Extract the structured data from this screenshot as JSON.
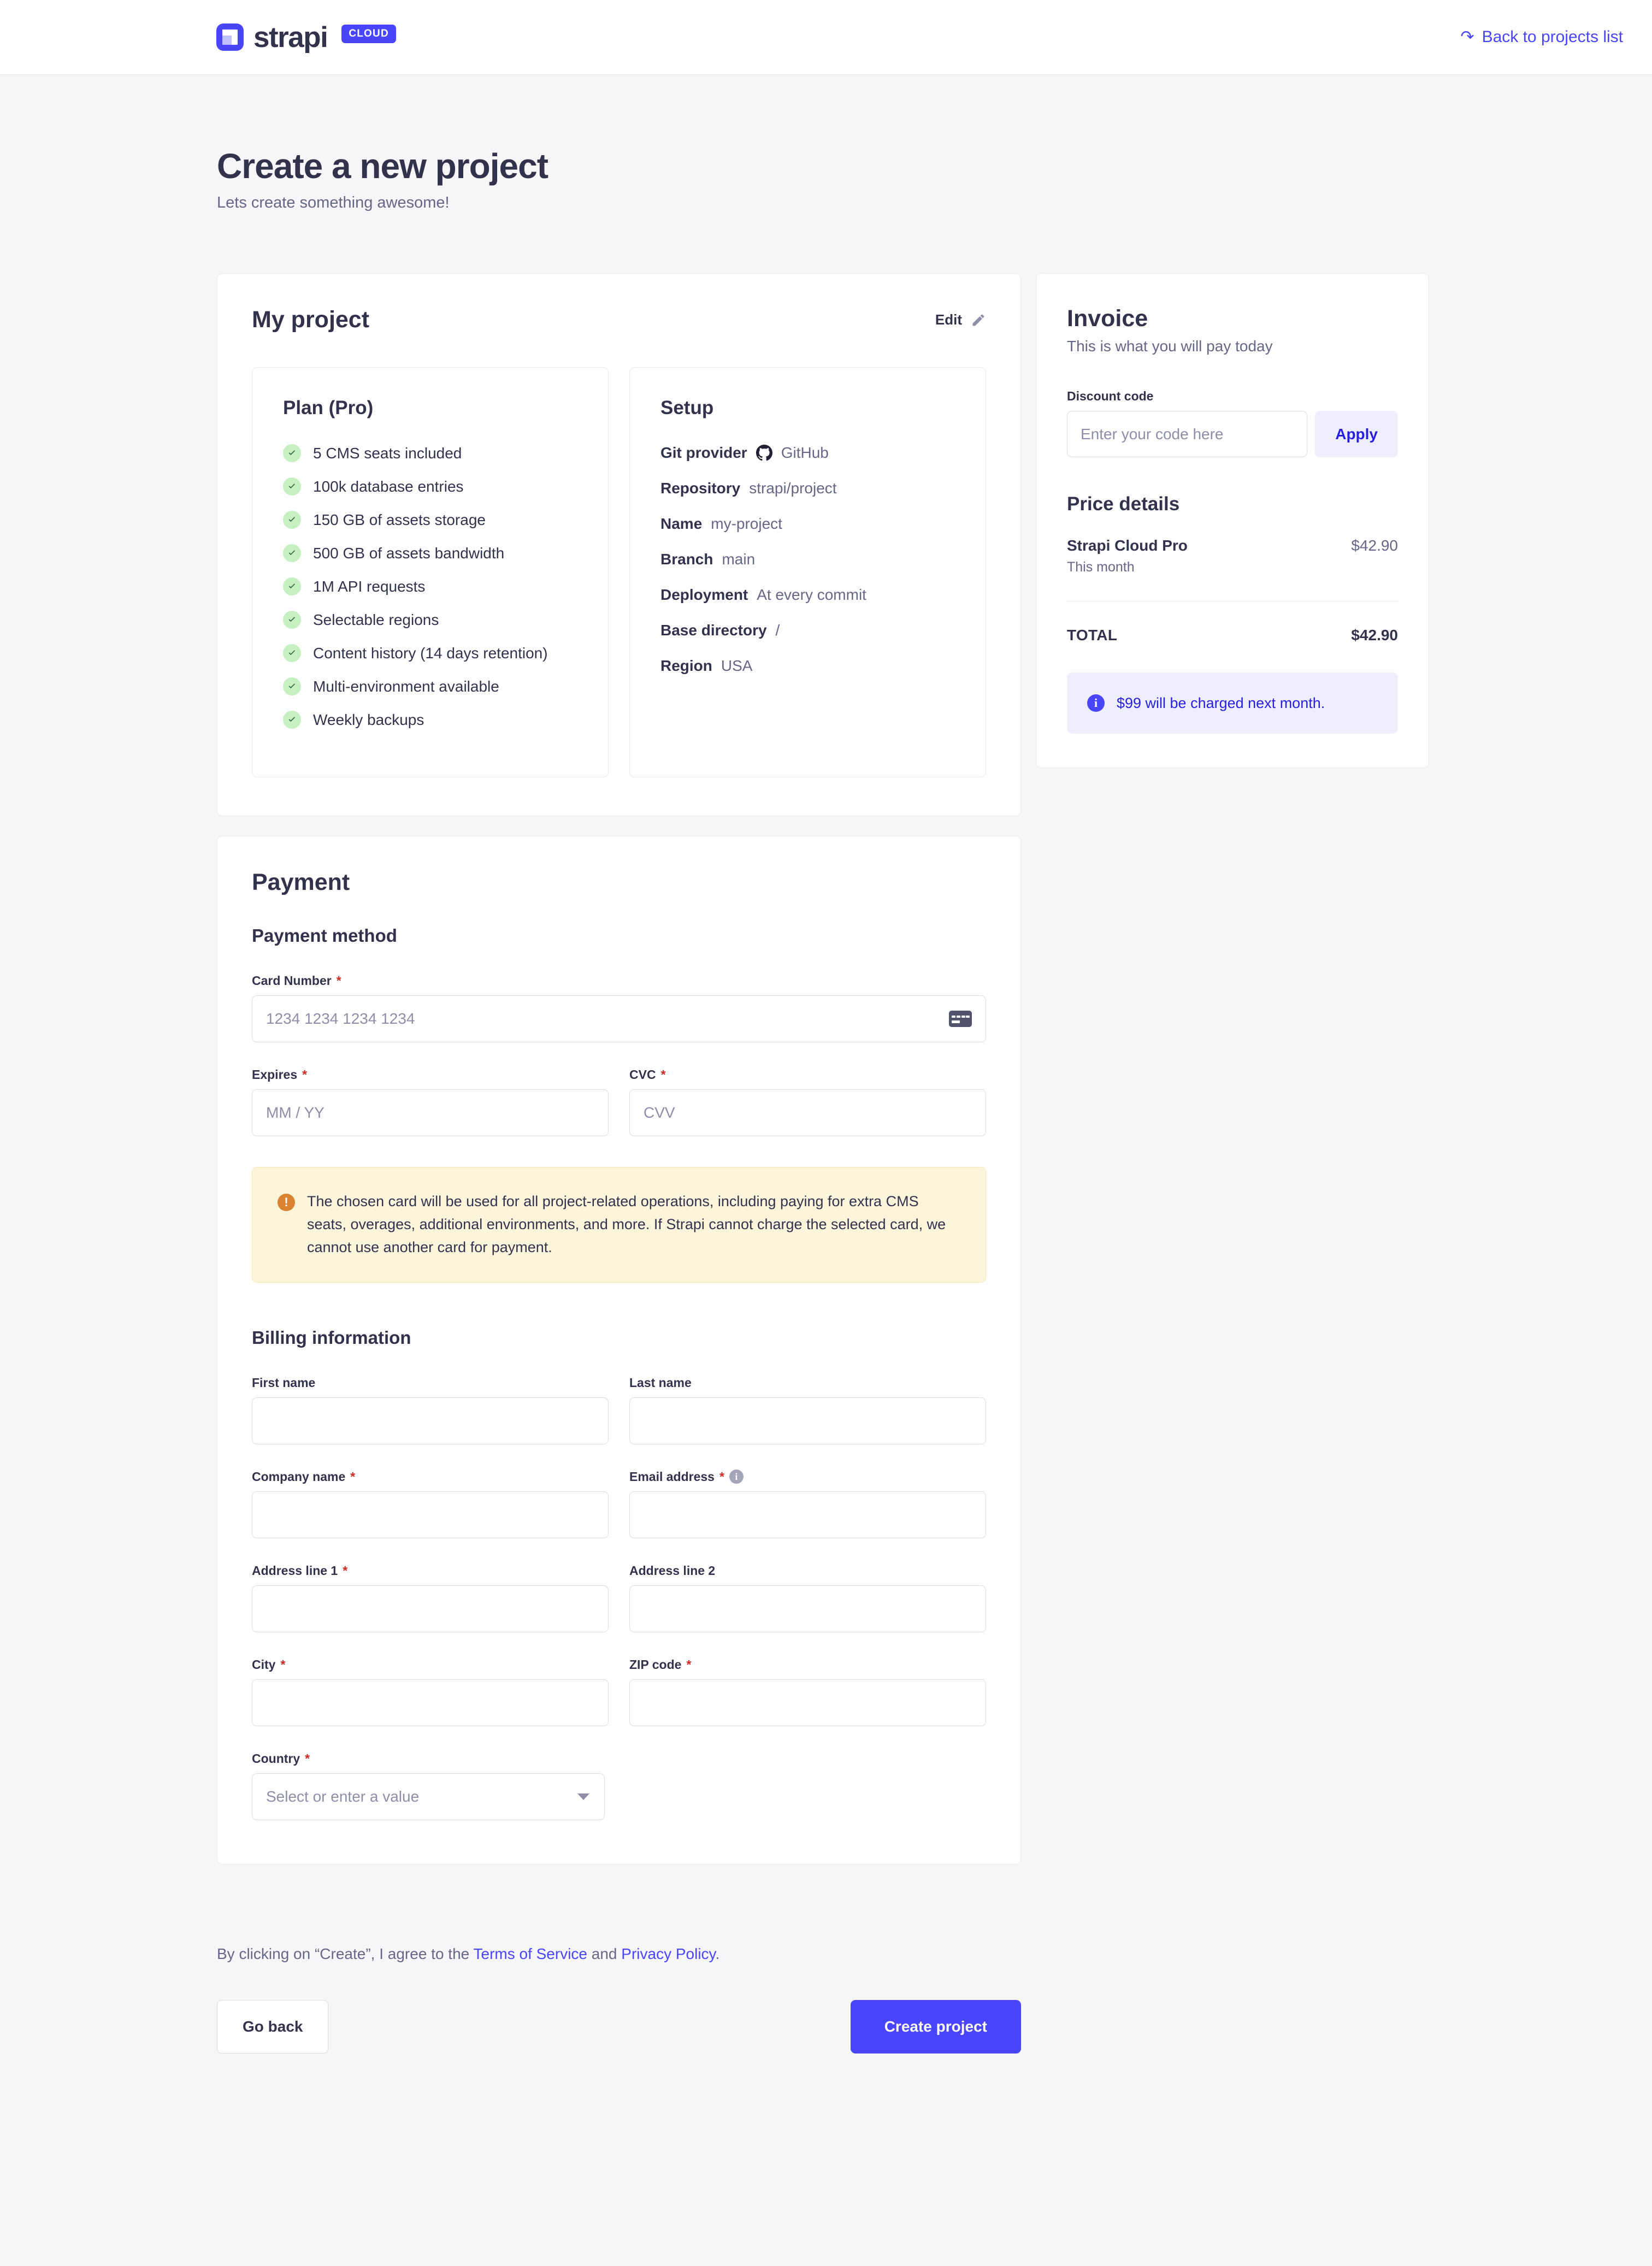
{
  "header": {
    "logo_text": "strapi",
    "logo_badge": "CLOUD",
    "back_link": "Back to projects list",
    "back_icon": "refresh-icon"
  },
  "page": {
    "title": "Create a new project",
    "subtitle": "Lets create something awesome!"
  },
  "project": {
    "name": "My project",
    "edit_label": "Edit",
    "plan": {
      "title": "Plan (Pro)",
      "features": [
        "5 CMS seats included",
        "100k database entries",
        "150 GB of assets storage",
        "500 GB of assets bandwidth",
        "1M API requests",
        "Selectable regions",
        "Content history (14 days retention)",
        "Multi-environment available",
        "Weekly backups"
      ]
    },
    "setup": {
      "title": "Setup",
      "rows": [
        {
          "key": "Git provider",
          "value": "GitHub",
          "icon": "github-icon"
        },
        {
          "key": "Repository",
          "value": "strapi/project"
        },
        {
          "key": "Name",
          "value": "my-project"
        },
        {
          "key": "Branch",
          "value": "main"
        },
        {
          "key": "Deployment",
          "value": "At every commit"
        },
        {
          "key": "Base directory",
          "value": "/"
        },
        {
          "key": "Region",
          "value": "USA"
        }
      ]
    }
  },
  "invoice": {
    "title": "Invoice",
    "subtitle": "This is what you will pay today",
    "discount_label": "Discount code",
    "discount_placeholder": "Enter your code here",
    "discount_value": "",
    "apply_label": "Apply",
    "price_details_title": "Price details",
    "line_items": [
      {
        "name": "Strapi Cloud Pro",
        "note": "This month",
        "amount": "$42.90"
      }
    ],
    "total_label": "TOTAL",
    "total_amount": "$42.90",
    "notice": "$99 will be charged next month."
  },
  "payment": {
    "title": "Payment",
    "method_title": "Payment method",
    "card_number_label": "Card Number",
    "card_number_placeholder": "1234 1234 1234 1234",
    "card_number_value": "",
    "expires_label": "Expires",
    "expires_placeholder": "MM / YY",
    "expires_value": "",
    "cvc_label": "CVC",
    "cvc_placeholder": "CVV",
    "cvc_value": "",
    "warning": "The chosen card will be used for all project-related operations, including paying for extra CMS seats, overages, additional environments, and more. If Strapi cannot charge the selected card, we cannot use another card for payment.",
    "billing_title": "Billing information",
    "fields": {
      "first_name_label": "First name",
      "first_name_value": "",
      "last_name_label": "Last name",
      "last_name_value": "",
      "company_label": "Company name",
      "company_value": "",
      "email_label": "Email address",
      "email_value": "",
      "address1_label": "Address line 1",
      "address1_value": "",
      "address2_label": "Address line 2",
      "address2_value": "",
      "city_label": "City",
      "city_value": "",
      "zip_label": "ZIP code",
      "zip_value": "",
      "country_label": "Country",
      "country_placeholder": "Select or enter a value"
    },
    "required_marker": "*"
  },
  "footer": {
    "terms_prefix": "By clicking on “Create”, I agree to the ",
    "terms_link": "Terms of Service",
    "terms_mid": " and ",
    "privacy_link": "Privacy Policy",
    "terms_suffix": ".",
    "go_back_label": "Go back",
    "create_label": "Create project"
  },
  "colors": {
    "accent": "#4945ff",
    "accent_dark": "#271fe0",
    "text": "#32324d",
    "muted": "#666687",
    "border": "#eaeaef",
    "page_bg": "#f6f6f9",
    "success": "#c6f0c2",
    "warning": "#d9822f",
    "warning_bg": "#fdf4dc",
    "required": "#d02b20"
  }
}
